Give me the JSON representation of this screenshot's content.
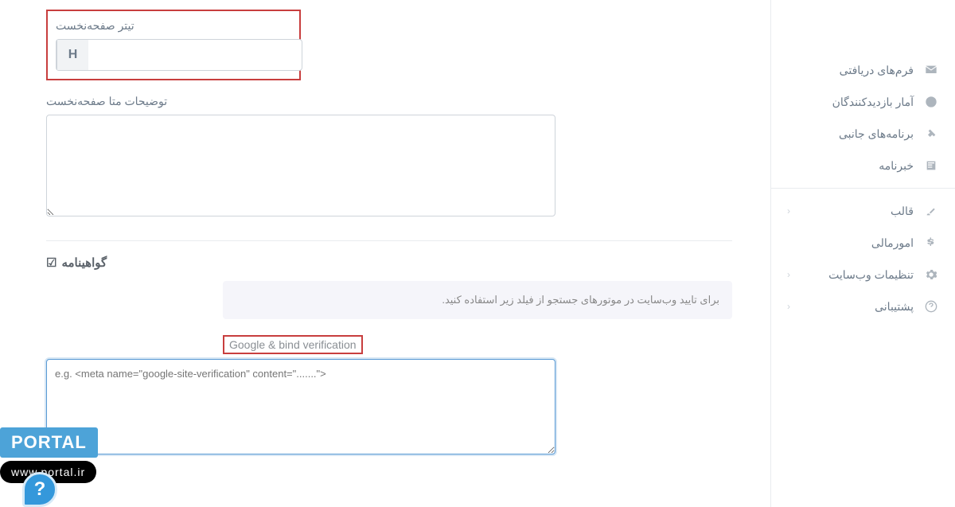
{
  "sidebar": {
    "group1": [
      {
        "label": "فرم‌های دریافتی",
        "icon": "envelope"
      },
      {
        "label": "آمار بازدیدکنندگان",
        "icon": "chart"
      },
      {
        "label": "برنامه‌های جانبی",
        "icon": "plug"
      },
      {
        "label": "خبرنامه",
        "icon": "news"
      }
    ],
    "group2": [
      {
        "label": "قالب",
        "icon": "brush",
        "chevron": true
      },
      {
        "label": "امورمالی",
        "icon": "dollar"
      },
      {
        "label": "تنظیمات وب‌سایت",
        "icon": "gear",
        "chevron": true
      },
      {
        "label": "پشتیبانی",
        "icon": "question",
        "chevron": true
      }
    ],
    "chevron_glyph": "‹"
  },
  "form": {
    "homepage_title_label": "تیتر صفحه‌نخست",
    "homepage_title_addon": "H",
    "homepage_title_value": "",
    "homepage_meta_label": "توضیحات متا صفحه‌نخست",
    "homepage_meta_value": ""
  },
  "cert_section": {
    "heading": "گواهینامه",
    "check_glyph": "☑",
    "info_text": "برای تایید وب‌سایت در موتورهای جستجو از فیلد زیر استفاده کنید.",
    "verification_label": "Google & bind verification",
    "verification_placeholder": "e.g. <meta name=\"google-site-verification\" content=\".......\">"
  },
  "branding": {
    "logo_text": "PORTAL",
    "url_text": "www.portal.ir"
  },
  "help_glyph": "?"
}
